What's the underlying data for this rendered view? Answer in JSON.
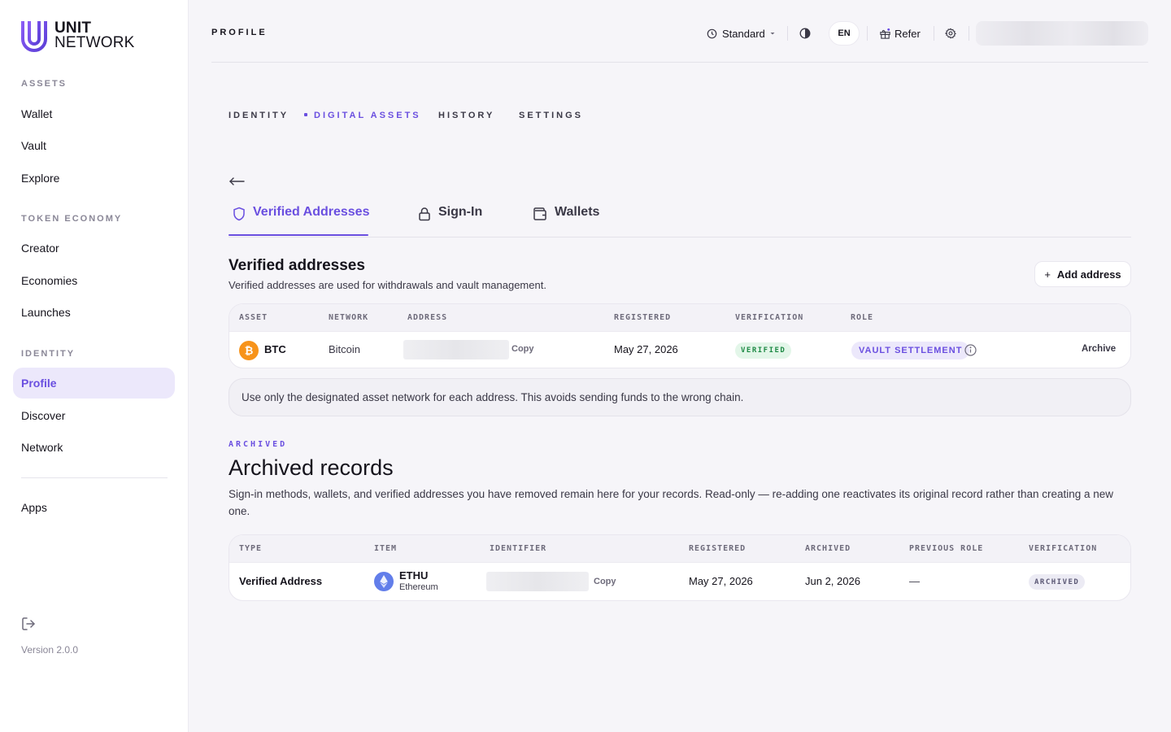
{
  "brand": {
    "line1": "UNIT",
    "line2": "NETWORK"
  },
  "sidebar": {
    "sections": [
      {
        "label": "ASSETS"
      },
      {
        "label": "TOKEN ECONOMY"
      },
      {
        "label": "IDENTITY"
      }
    ],
    "items": [
      {
        "label": "Wallet"
      },
      {
        "label": "Vault"
      },
      {
        "label": "Explore"
      },
      {
        "label": "Creator"
      },
      {
        "label": "Economies"
      },
      {
        "label": "Launches"
      },
      {
        "label": "Profile",
        "active": true
      },
      {
        "label": "Discover"
      },
      {
        "label": "Network"
      },
      {
        "label": "Apps"
      }
    ],
    "version": "Version 2.0.0"
  },
  "header": {
    "title": "PROFILE",
    "mode": "Standard",
    "language": "EN",
    "refer": "Refer"
  },
  "tabs": [
    "IDENTITY",
    "DIGITAL ASSETS",
    "HISTORY",
    "SETTINGS"
  ],
  "active_tab": "DIGITAL ASSETS",
  "subtabs": [
    "Verified Addresses",
    "Sign-In",
    "Wallets"
  ],
  "active_subtab": "Verified Addresses",
  "verified": {
    "title": "Verified addresses",
    "subtitle": "Verified addresses are used for withdrawals and vault management.",
    "add_button": "Add address",
    "columns": [
      "ASSET",
      "NETWORK",
      "ADDRESS",
      "REGISTERED",
      "VERIFICATION",
      "ROLE"
    ],
    "row": {
      "asset": "BTC",
      "network": "Bitcoin",
      "copy": "Copy",
      "registered": "May 27, 2026",
      "verification": "VERIFIED",
      "role": "VAULT SETTLEMENT",
      "action": "Archive"
    }
  },
  "notice": "Use only the designated asset network for each address. This avoids sending funds to the wrong chain.",
  "archived": {
    "eyebrow": "ARCHIVED",
    "title": "Archived records",
    "description": "Sign-in methods, wallets, and verified addresses you have removed remain here for your records. Read-only — re-adding one reactivates its original record rather than creating a new one.",
    "columns": [
      "TYPE",
      "ITEM",
      "IDENTIFIER",
      "REGISTERED",
      "ARCHIVED",
      "PREVIOUS ROLE",
      "VERIFICATION"
    ],
    "row": {
      "type": "Verified Address",
      "item": "ETHU",
      "item_network": "Ethereum",
      "copy": "Copy",
      "registered": "May 27, 2026",
      "archived": "Jun 2, 2026",
      "previous_role": "—",
      "verification": "ARCHIVED"
    }
  },
  "colors": {
    "accent": "#6a4fe0",
    "btc": "#f7931a",
    "eth": "#627eea",
    "verified": "#1e8a45"
  }
}
